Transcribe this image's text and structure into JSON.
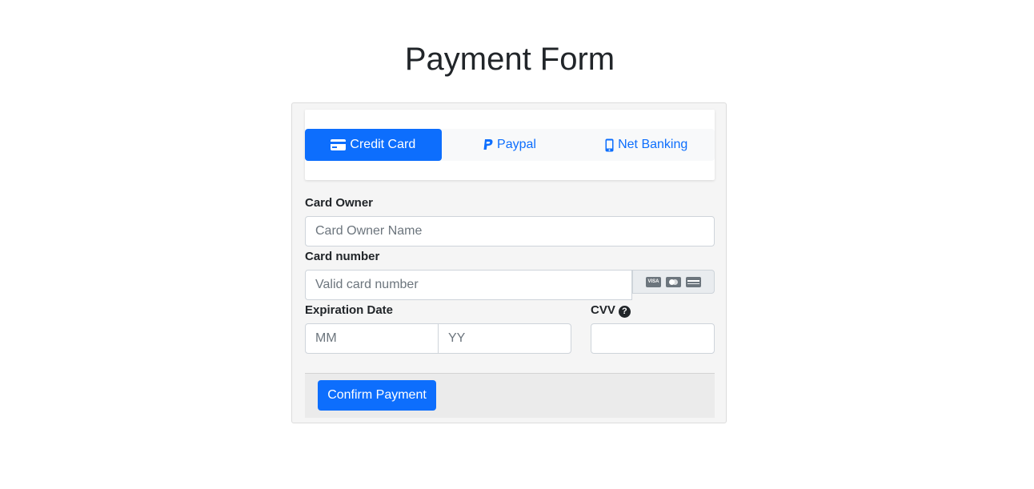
{
  "page": {
    "title": "Payment Form"
  },
  "tabs": [
    {
      "label": "Credit Card",
      "icon": "credit-card-icon",
      "active": true
    },
    {
      "label": "Paypal",
      "icon": "paypal-icon",
      "active": false
    },
    {
      "label": "Net Banking",
      "icon": "mobile-icon",
      "active": false
    }
  ],
  "form": {
    "card_owner": {
      "label": "Card Owner",
      "placeholder": "Card Owner Name",
      "value": ""
    },
    "card_number": {
      "label": "Card number",
      "placeholder": "Valid card number",
      "value": "",
      "addon_icons": [
        "visa-icon",
        "mastercard-icon",
        "credit-card-icon"
      ]
    },
    "expiration": {
      "label": "Expiration Date",
      "month_placeholder": "MM",
      "year_placeholder": "YY"
    },
    "cvv": {
      "label": "CVV",
      "help_icon": "question-circle-icon",
      "value": ""
    }
  },
  "footer": {
    "confirm_label": "Confirm Payment"
  },
  "colors": {
    "primary": "#0d6efd",
    "card_bg": "#f5f5f5",
    "footer_bg": "#ebebeb"
  }
}
